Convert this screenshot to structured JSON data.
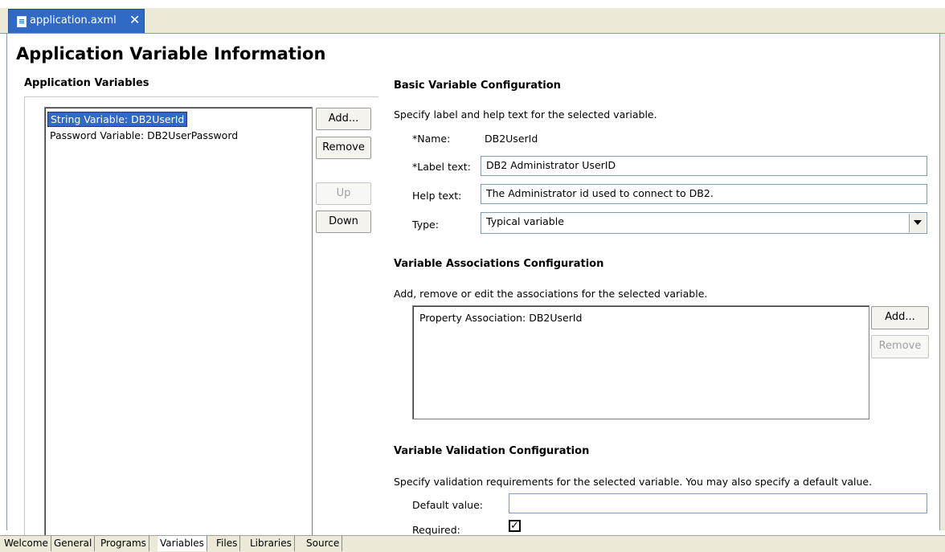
{
  "editor_tab": {
    "title": "application.axml",
    "close_glyph": "✕"
  },
  "page_title": "Application Variable Information",
  "app_vars": {
    "heading": "Application Variables",
    "items": [
      "String Variable: DB2UserId",
      "Password Variable: DB2UserPassword"
    ],
    "selected_index": 0,
    "buttons": {
      "add": "Add...",
      "remove": "Remove",
      "up": "Up",
      "down": "Down"
    }
  },
  "basic": {
    "heading": "Basic Variable Configuration",
    "description": "Specify label and help text for the selected variable.",
    "name_label": "*Name:",
    "name_value": "DB2UserId",
    "label_text_label": "*Label text:",
    "label_text_value": "DB2 Administrator UserID",
    "help_text_label": "Help text:",
    "help_text_value": "The Administrator id used to connect to DB2.",
    "type_label": "Type:",
    "type_value": "Typical variable"
  },
  "assoc": {
    "heading": "Variable Associations Configuration",
    "description": "Add, remove or edit the associations for the selected variable.",
    "items": [
      "Property Association: DB2UserId"
    ],
    "buttons": {
      "add": "Add...",
      "remove": "Remove"
    }
  },
  "validation": {
    "heading": "Variable Validation Configuration",
    "description": "Specify validation requirements for the selected variable. You may also specify a default value.",
    "default_label": "Default value:",
    "default_value": "",
    "required_label": "Required:",
    "required_checked": true
  },
  "bottom_tabs": [
    {
      "label": "Welcome"
    },
    {
      "label": "General"
    },
    {
      "label": "Programs"
    },
    {
      "label": "Variables"
    },
    {
      "label": "Files"
    },
    {
      "label": "Libraries"
    },
    {
      "label": "Source"
    }
  ],
  "active_bottom_tab": "Variables",
  "colors": {
    "selection": "#316ac5",
    "frame": "#ece9d8",
    "border": "#7f9db9"
  }
}
